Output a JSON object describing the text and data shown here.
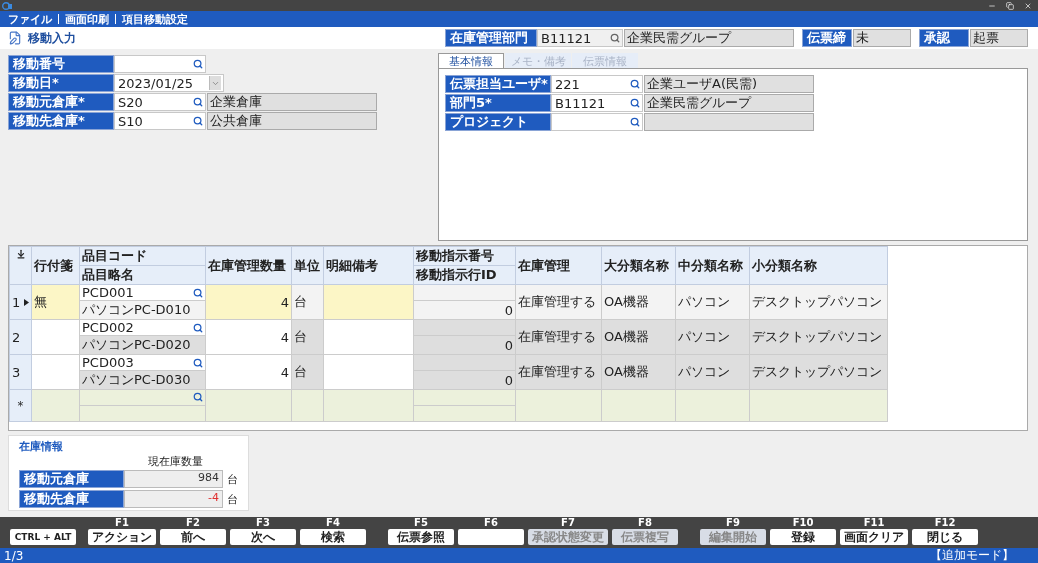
{
  "menu": [
    "ファイル",
    "画面印刷",
    "項目移動設定"
  ],
  "title": "移動入力",
  "header_fields": [
    {
      "kind": "lookup",
      "label": "在庫管理部門",
      "value": "B11121",
      "name": "企業民需グループ"
    },
    {
      "kind": "plain",
      "label": "伝票締",
      "value": "未"
    },
    {
      "kind": "plain",
      "label": "承認",
      "value": "起票"
    }
  ],
  "form": [
    {
      "kind": "search",
      "label": "移動番号"
    },
    {
      "kind": "date",
      "label": "移動日*",
      "value": "2023/01/25"
    },
    {
      "kind": "lookup",
      "label": "移動元倉庫*",
      "value": "S20",
      "name": "企業倉庫"
    },
    {
      "kind": "lookup",
      "label": "移動先倉庫*",
      "value": "S10",
      "name": "公共倉庫"
    }
  ],
  "tabs": [
    {
      "label": "基本情報",
      "selected": true
    },
    {
      "label": "メモ・備考",
      "selected": false
    },
    {
      "label": "伝票情報",
      "selected": false
    }
  ],
  "tab_fields": [
    {
      "label": "伝票担当ユーザ*",
      "value": "221",
      "name": "企業ユーザA(民需)"
    },
    {
      "label": "部門5*",
      "value": "B11121",
      "name": "企業民需グループ"
    },
    {
      "label": "プロジェクト"
    }
  ],
  "grid": {
    "columns": [
      [
        "行付箋"
      ],
      [
        "品目コード",
        "品目略名"
      ],
      [
        "在庫管理数量"
      ],
      [
        "単位"
      ],
      [
        "明細備考"
      ],
      [
        "移動指示番号",
        "移動指示行ID"
      ],
      [
        "在庫管理"
      ],
      [
        "大分類名称"
      ],
      [
        "中分類名称"
      ],
      [
        "小分類名称"
      ]
    ],
    "rows": [
      {
        "number": "1",
        "selected": true,
        "tag": "無",
        "code": "PCD001",
        "item_name": "パソコンPC-D010",
        "qty": "4",
        "unit": "台",
        "instruction_line": "0",
        "stock_mgmt": "在庫管理する",
        "major": "OA機器",
        "middle": "パソコン",
        "minor": "デスクトップパソコン"
      },
      {
        "number": "2",
        "selected": false,
        "code": "PCD002",
        "item_name": "パソコンPC-D020",
        "qty": "4",
        "unit": "台",
        "instruction_line": "0",
        "stock_mgmt": "在庫管理する",
        "major": "OA機器",
        "middle": "パソコン",
        "minor": "デスクトップパソコン"
      },
      {
        "number": "3",
        "selected": false,
        "code": "PCD003",
        "item_name": "パソコンPC-D030",
        "qty": "4",
        "unit": "台",
        "instruction_line": "0",
        "stock_mgmt": "在庫管理する",
        "major": "OA機器",
        "middle": "パソコン",
        "minor": "デスクトップパソコン"
      }
    ],
    "new_row_marker": "＊"
  },
  "stock_info": {
    "title": "在庫情報",
    "column": "現在庫数量",
    "rows": [
      {
        "label": "移動元倉庫",
        "value": "984",
        "unit": "台",
        "negative": false
      },
      {
        "label": "移動先倉庫",
        "value": "-4",
        "unit": "台",
        "negative": true
      }
    ]
  },
  "function_keys": {
    "modifier": "CTRL + ALT",
    "keys": [
      {
        "key": "F1",
        "label": "アクション",
        "disabled": false
      },
      {
        "key": "F2",
        "label": "前へ",
        "disabled": false
      },
      {
        "key": "F3",
        "label": "次へ",
        "disabled": false
      },
      {
        "key": "F4",
        "label": "検索",
        "disabled": false
      },
      {
        "key": "F5",
        "label": "伝票参照",
        "disabled": false
      },
      {
        "key": "F6",
        "disabled": false
      },
      {
        "key": "F7",
        "label": "承認状態変更",
        "disabled": true
      },
      {
        "key": "F8",
        "label": "伝票複写",
        "disabled": true
      },
      {
        "key": "F9",
        "label": "編集開始",
        "disabled": true
      },
      {
        "key": "F10",
        "label": "登録",
        "disabled": false
      },
      {
        "key": "F11",
        "label": "画面クリア",
        "disabled": false
      },
      {
        "key": "F12",
        "label": "閉じる",
        "disabled": false
      }
    ]
  },
  "status": {
    "page": "1/3",
    "mode": "【追加モード】"
  }
}
